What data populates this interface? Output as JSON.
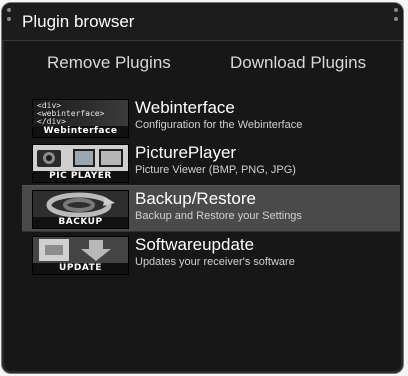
{
  "window": {
    "title": "Plugin browser"
  },
  "tabs": {
    "remove": "Remove Plugins",
    "download": "Download Plugins"
  },
  "plugins": [
    {
      "name": "Webinterface",
      "description": "Configuration for the Webinterface",
      "thumb_caption": "Webinterface",
      "icon": "webinterface-icon",
      "selected": false
    },
    {
      "name": "PicturePlayer",
      "description": "Picture Viewer (BMP, PNG, JPG)",
      "thumb_caption": "PIC PLAYER",
      "icon": "picture-player-icon",
      "selected": false
    },
    {
      "name": "Backup/Restore",
      "description": "Backup and Restore your Settings",
      "thumb_caption": "BACKUP",
      "icon": "backup-icon",
      "selected": true
    },
    {
      "name": "Softwareupdate",
      "description": "Updates your receiver's software",
      "thumb_caption": "UPDATE",
      "icon": "software-update-icon",
      "selected": false
    }
  ],
  "thumb_markup": {
    "webinterface": "<div>\n<webinterface>\n</div>"
  },
  "colors": {
    "background": "#171717",
    "selected_row": "#4a4a4a",
    "text": "#ffffff"
  }
}
